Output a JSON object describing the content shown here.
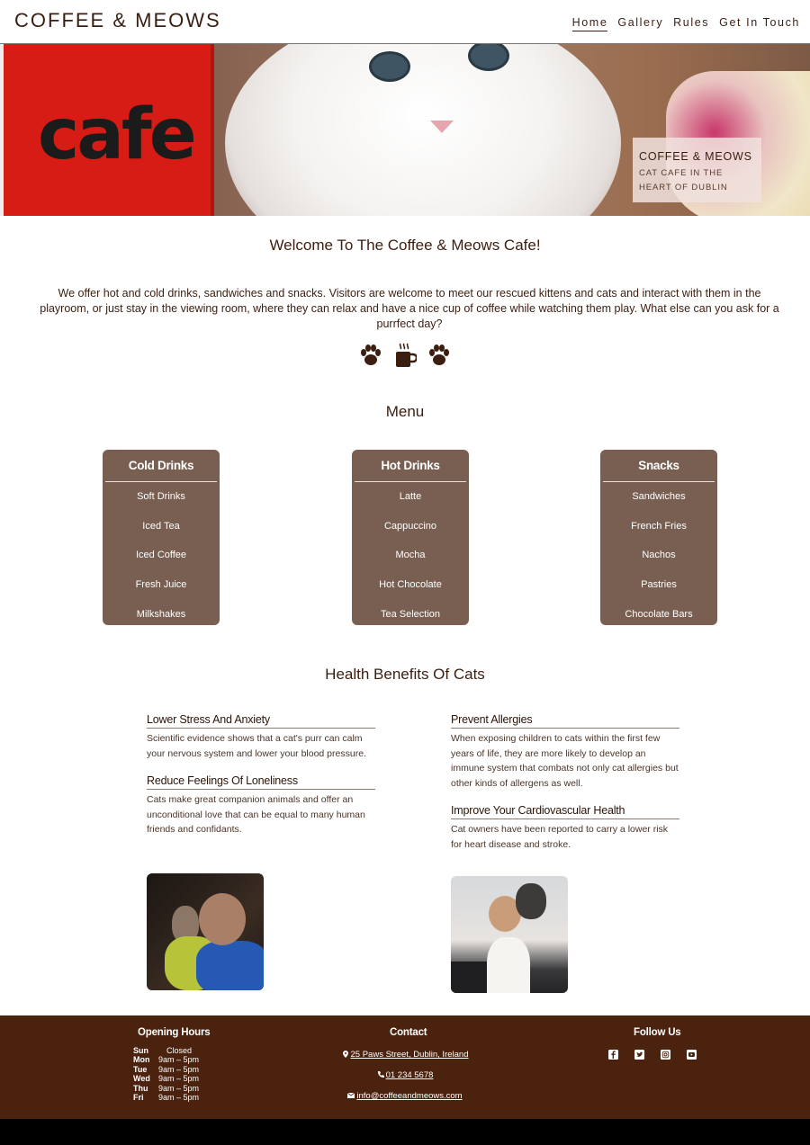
{
  "nav": {
    "brand": "COFFEE & MEOWS",
    "links": [
      "Home",
      "Gallery",
      "Rules",
      "Get In Touch"
    ],
    "active": "Home"
  },
  "hero": {
    "mug_text": "cafe",
    "caption_title": "COFFEE & MEOWS",
    "caption_subtitle": "CAT CAFE IN THE HEART OF DUBLIN"
  },
  "welcome": {
    "title": "Welcome To The Coffee & Meows Cafe!",
    "text": "We offer hot and cold drinks, sandwiches and snacks. Visitors are welcome to meet our rescued kittens and cats and interact with them in the playroom, or just stay in the viewing room, where they can relax and have a nice cup of coffee while watching them play. What else can you ask for a purrfect day?",
    "icons": [
      "paw-icon",
      "coffee-mug-icon",
      "paw-icon"
    ]
  },
  "menu": {
    "title": "Menu",
    "categories": [
      {
        "name": "Cold Drinks",
        "items": [
          "Soft Drinks",
          "Iced Tea",
          "Iced Coffee",
          "Fresh Juice",
          "Milkshakes"
        ]
      },
      {
        "name": "Hot Drinks",
        "items": [
          "Latte",
          "Cappuccino",
          "Mocha",
          "Hot Chocolate",
          "Tea Selection"
        ]
      },
      {
        "name": "Snacks",
        "items": [
          "Sandwiches",
          "French Fries",
          "Nachos",
          "Pastries",
          "Chocolate Bars"
        ]
      }
    ]
  },
  "health": {
    "title": "Health Benefits Of Cats",
    "benefits": [
      {
        "title": "Lower Stress And Anxiety",
        "text": "Scientific evidence shows that a cat's purr can calm your nervous system and lower your blood pressure."
      },
      {
        "title": "Reduce Feelings Of Loneliness",
        "text": "Cats make great companion animals and offer an unconditional love that can be equal to many human friends and confidants."
      },
      {
        "title": "Prevent Allergies",
        "text": "When exposing children to cats within the first few years of life, they are more likely to develop an immune system that combats not only cat allergies but other kinds of allergens as well."
      },
      {
        "title": "Improve Your Cardiovascular Health",
        "text": "Cat owners have been reported to carry a lower risk for heart disease and stroke."
      }
    ]
  },
  "footer": {
    "hours_title": "Opening Hours",
    "hours": [
      {
        "day": "Sun",
        "time": "Closed"
      },
      {
        "day": "Mon",
        "time": "9am – 5pm"
      },
      {
        "day": "Tue",
        "time": "9am – 5pm"
      },
      {
        "day": "Wed",
        "time": "9am – 5pm"
      },
      {
        "day": "Thu",
        "time": "9am – 5pm"
      },
      {
        "day": "Fri",
        "time": "9am – 5pm"
      }
    ],
    "contact_title": "Contact",
    "address": "25 Paws Street, Dublin, Ireland",
    "phone": "01 234 5678",
    "email": "info@coffeeandmeows.com",
    "follow_title": "Follow Us",
    "social_icons": [
      "facebook-icon",
      "twitter-icon",
      "instagram-icon",
      "youtube-icon"
    ]
  },
  "colors": {
    "brand_brown": "#3b1e10",
    "menu_card": "#785f51",
    "footer_bg": "#4a220e"
  }
}
